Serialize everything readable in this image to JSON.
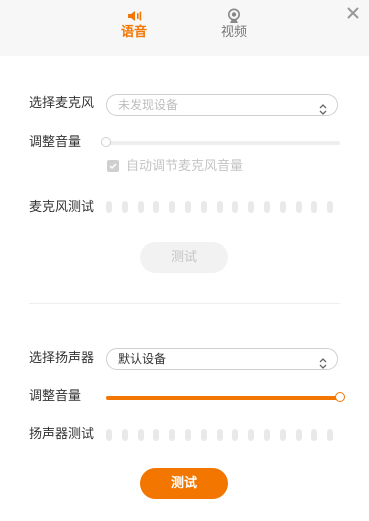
{
  "colors": {
    "accent": "#f27600",
    "disabled_text": "#c4c4c4",
    "label_text": "#333333",
    "meter_segment": "#e9e9e9"
  },
  "tabs": [
    {
      "label": "语音",
      "icon": "speaker-icon",
      "active": true
    },
    {
      "label": "视频",
      "icon": "webcam-icon",
      "active": false
    }
  ],
  "close": {
    "icon": "close-icon"
  },
  "microphone": {
    "select_label": "选择麦克风",
    "selected_device": "未发现设备",
    "volume_label": "调整音量",
    "volume_level": 0,
    "auto_adjust_label": "自动调节麦克风音量",
    "auto_adjust_checked": true,
    "test_label": "麦克风测试",
    "meter_segments": 15,
    "meter_active": 0,
    "test_button": "测试",
    "test_enabled": false
  },
  "speaker": {
    "select_label": "选择扬声器",
    "selected_device": "默认设备",
    "volume_label": "调整音量",
    "volume_level": 1.0,
    "test_label": "扬声器测试",
    "meter_segments": 15,
    "meter_active": 0,
    "test_button": "测试",
    "test_enabled": true
  }
}
